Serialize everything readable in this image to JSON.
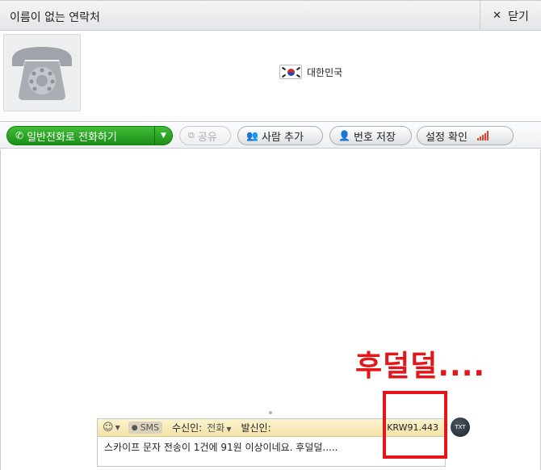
{
  "window": {
    "title": "이름이 없는 연락처",
    "close_label": "닫기"
  },
  "profile": {
    "country": "대한민국"
  },
  "toolbar": {
    "call_label": "일반전화로 전화하기",
    "share_label": "공유",
    "add_person_label": "사람 추가",
    "save_number_label": "번호 저장",
    "settings_label": "설정 확인"
  },
  "annotation": {
    "text": "후덜덜...."
  },
  "compose": {
    "sms_label": "SMS",
    "recipient_label": "수신인:",
    "recipient_value": "전화",
    "sender_label": "발신인:",
    "price": "KRW91.443",
    "message": "스카이프 문자 전송이 1건에 91원 이상이네요. 후덜덜.....",
    "send_label": "TXT"
  },
  "colors": {
    "call_green": "#2aa824",
    "annotation_red": "#e4161a",
    "compose_bar": "#f7eab9"
  }
}
